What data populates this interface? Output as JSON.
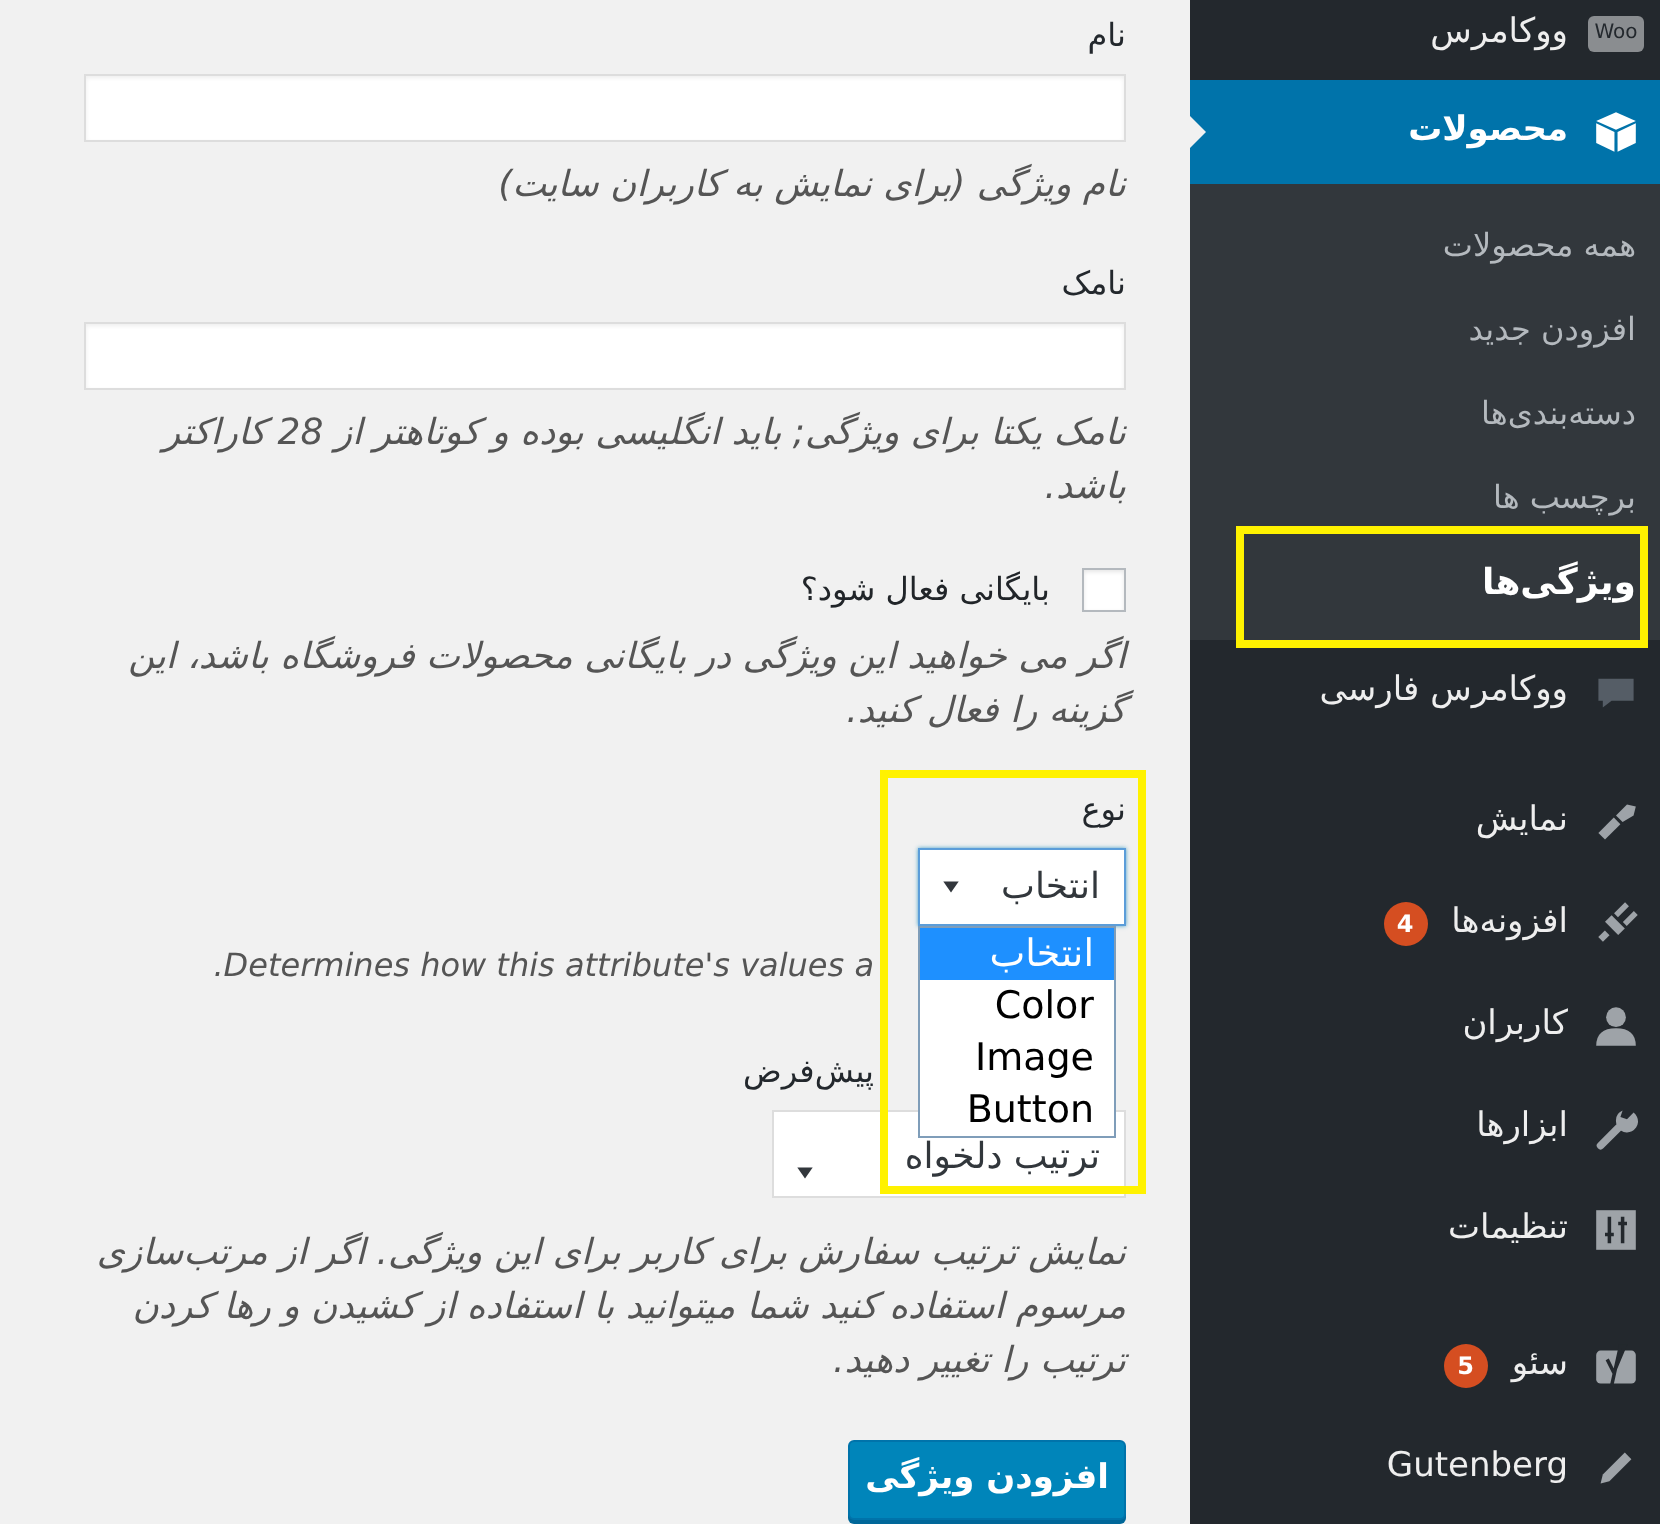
{
  "sidebar": {
    "sections": [
      {
        "items": [
          {
            "label": "ووکامرس",
            "logo_text": "Woo",
            "selected": false
          },
          {
            "label": "محصولات",
            "selected": true,
            "children": [
              {
                "label": "همه محصولات",
                "selected": false
              },
              {
                "label": "افزودن جدید",
                "selected": false
              },
              {
                "label": "دسته‌بندی‌ها",
                "selected": false
              },
              {
                "label": "برچسب ها",
                "selected": false
              },
              {
                "label": "ویژگی‌ها",
                "selected": true,
                "highlighted": true
              }
            ]
          },
          {
            "label": "ووکامرس فارسی",
            "selected": false
          }
        ]
      },
      {
        "items": [
          {
            "label": "نمایش",
            "selected": false
          },
          {
            "label": "افزونه‌ها",
            "badge": "4",
            "selected": false
          },
          {
            "label": "کاربران",
            "selected": false
          },
          {
            "label": "ابزارها",
            "selected": false
          },
          {
            "label": "تنظیمات",
            "selected": false
          }
        ]
      },
      {
        "items": [
          {
            "label": "سئو",
            "badge": "5",
            "selected": false
          },
          {
            "label": "Gutenberg",
            "selected": false
          }
        ]
      }
    ]
  },
  "form": {
    "fields": [
      {
        "kind": "text",
        "label": "نام",
        "description": "نام ویژگی (برای نمایش به کاربران سایت)"
      },
      {
        "kind": "text",
        "label": "نامک",
        "description": "نامک یکتا برای ویژگی; باید انگلیسی بوده و کوتاهتر از 28 کاراکتر باشد."
      },
      {
        "kind": "checkbox",
        "label": "بایگانی فعال شود؟",
        "checked": false,
        "description": "اگر می خواهید این ویژگی در بایگانی محصولات فروشگاه باشد، این گزینه را فعال کنید."
      },
      {
        "kind": "select",
        "label": "نوع",
        "value": "انتخاب",
        "expanded": true,
        "highlighted": true,
        "options": [
          {
            "label": "انتخاب",
            "selected": true
          },
          {
            "label": "Color",
            "selected": false
          },
          {
            "label": "Image",
            "selected": false
          },
          {
            "label": "Button",
            "selected": false
          }
        ],
        "description": "Determines how this attribute's values a."
      },
      {
        "kind": "select",
        "label": "پیش‌فرض",
        "value": "ترتیب دلخواه",
        "expanded": false,
        "description": "نمایش ترتیب سفارش برای کاربر برای این ویژگی. اگر از مرتب‌سازی مرسوم استفاده کنید شما میتوانید با استفاده از کشیدن و رها کردن ترتیب را تغییر دهید."
      }
    ],
    "submit": "افزودن ویژگی"
  }
}
